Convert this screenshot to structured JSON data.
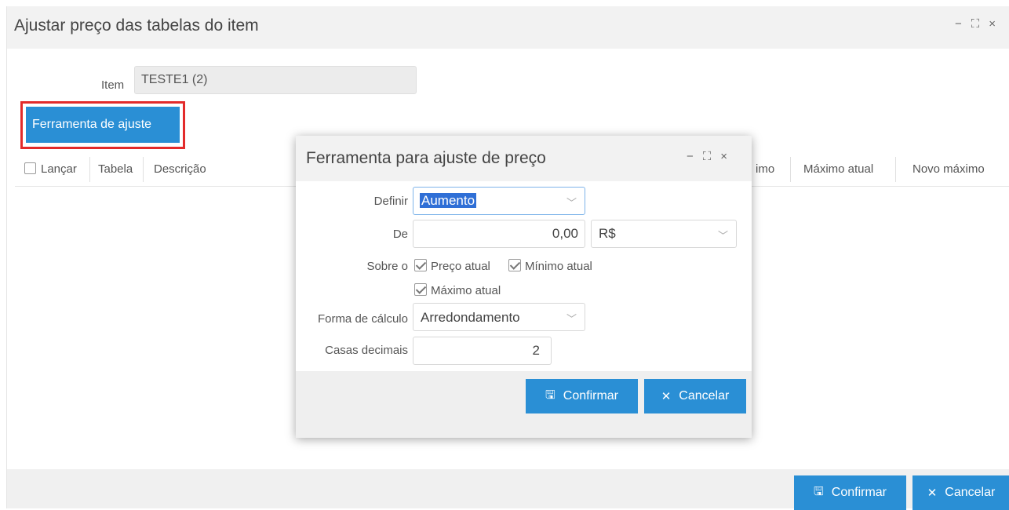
{
  "window": {
    "title": "Ajustar preço das tabelas do item",
    "minimize": "−",
    "maximize": "⛶",
    "close": "×"
  },
  "item": {
    "label": "Item",
    "value": "TESTE1 (2)"
  },
  "tool_button": {
    "label": "Ferramenta de ajuste"
  },
  "grid": {
    "columns": [
      "Lançar",
      "Tabela",
      "Descrição",
      "imo",
      "Máximo atual",
      "Novo máximo"
    ]
  },
  "footer": {
    "confirm_label": "Confirmar",
    "cancel_label": "Cancelar"
  },
  "modal": {
    "title": "Ferramenta para ajuste de preço",
    "minimize": "−",
    "maximize": "⛶",
    "close": "×",
    "definir_label": "Definir",
    "definir_value": "Aumento",
    "de_label": "De",
    "de_value": "0,00",
    "de_unit": "R$",
    "sobre_label": "Sobre o",
    "sobre_options": [
      "Preço atual",
      "Mínimo atual",
      "Máximo atual"
    ],
    "forma_label": "Forma de cálculo",
    "forma_value": "Arredondamento",
    "casas_label": "Casas decimais",
    "casas_value": "2",
    "confirm_label": "Confirmar",
    "cancel_label": "Cancelar"
  },
  "colors": {
    "accent": "#2a8fd5",
    "highlight": "#e32b2b",
    "selection": "#2f6fd6"
  }
}
